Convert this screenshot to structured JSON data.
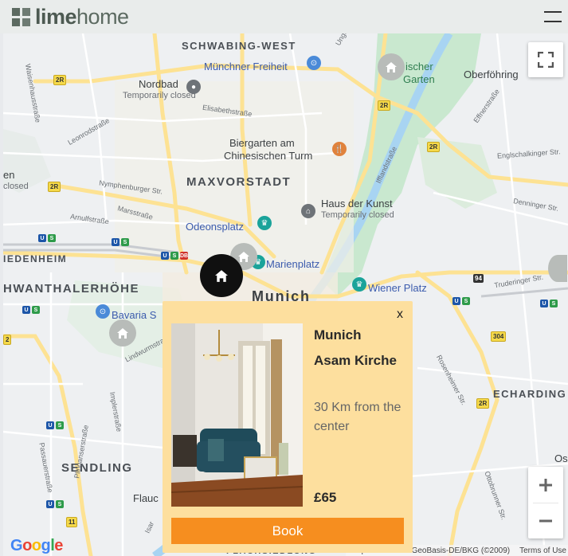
{
  "header": {
    "logo_bold": "lime",
    "logo_light": "home",
    "menu_icon": "hamburger-menu-icon"
  },
  "map": {
    "districts": {
      "schwabing_west": "SCHWABING-WEST",
      "maxvorstadt": "MAXVORSTADT",
      "munich": "Munich",
      "schwanthalerhoehe": "HWANTHALERHÖHE",
      "westend": "IEDENHEIM",
      "sendling": "SENDLING",
      "echarding": "ECHARDING",
      "flachsiedlung": "FLACHSIEDLUNG"
    },
    "pois": {
      "muenchner_freiheit": "Münchner Freiheit",
      "nordbad": "Nordbad",
      "nordbad_status": "Temporarily closed",
      "biergarten": "Biergarten am",
      "biergarten2": "Chinesischen Turm",
      "haus_der_kunst": "Haus der Kunst",
      "haus_status": "Temporarily closed",
      "odeonsplatz": "Odeonsplatz",
      "marienplatz": "Marienplatz",
      "wiener_platz": "Wiener Platz",
      "bavaria": "Bavaria S",
      "oberfoehring": "Oberföhring",
      "ischer_garten1": "ischer",
      "ischer_garten2": "Garten",
      "flauc": "Flauc",
      "os": "Os",
      "en": "en",
      "closed": "closed"
    },
    "streets": {
      "elisabethstrasse": "Elisabethstraße",
      "leonrodstrasse": "Leonrodstraße",
      "nymphenburger": "Nymphenburger Str.",
      "arnulfstrasse": "Arnulfstraße",
      "marsstrasse": "Marsstraße",
      "lindwurmstrasse": "Lindwurmstraße",
      "implerstrasse": "Implerstraße",
      "passauerstrasse": "Passauerstraße",
      "plinganserstrasse": "Plinganserstraße",
      "effnerstrasse": "Effnerstraße",
      "englschalkinger": "Englschalkinger Str.",
      "denninger": "Denninger Str.",
      "truderinger": "Truderinger Str.",
      "rosenheimer": "Rosenheimer Str.",
      "ottobrunner": "Ottobrunner Str.",
      "ifflandstrasse": "Ifflandstraße",
      "isar": "Isar",
      "waisenhaus": "Waisenhausstraße",
      "unger": "Unge"
    },
    "shields": [
      "2R",
      "2R",
      "2R",
      "2R",
      "2R",
      "2R",
      "94",
      "304",
      "11",
      "2"
    ],
    "attribution": "Map data ©2021 GeoBasis-DE/BKG (©2009)",
    "terms": "Terms of Use",
    "google": "Google"
  },
  "controls": {
    "fullscreen_icon": "fullscreen-icon",
    "zoom_in": "+",
    "zoom_out": "−"
  },
  "card": {
    "close": "x",
    "city": "Munich",
    "name": "Asam Kirche",
    "distance": "30 Km from the center",
    "price": "£65",
    "book": "Book"
  },
  "colors": {
    "card_bg": "#fddf9e",
    "book_button": "#f68e1f",
    "brand_grey": "#5c6a61",
    "active_marker": "#101010",
    "inactive_marker": "#b8bcb9"
  }
}
